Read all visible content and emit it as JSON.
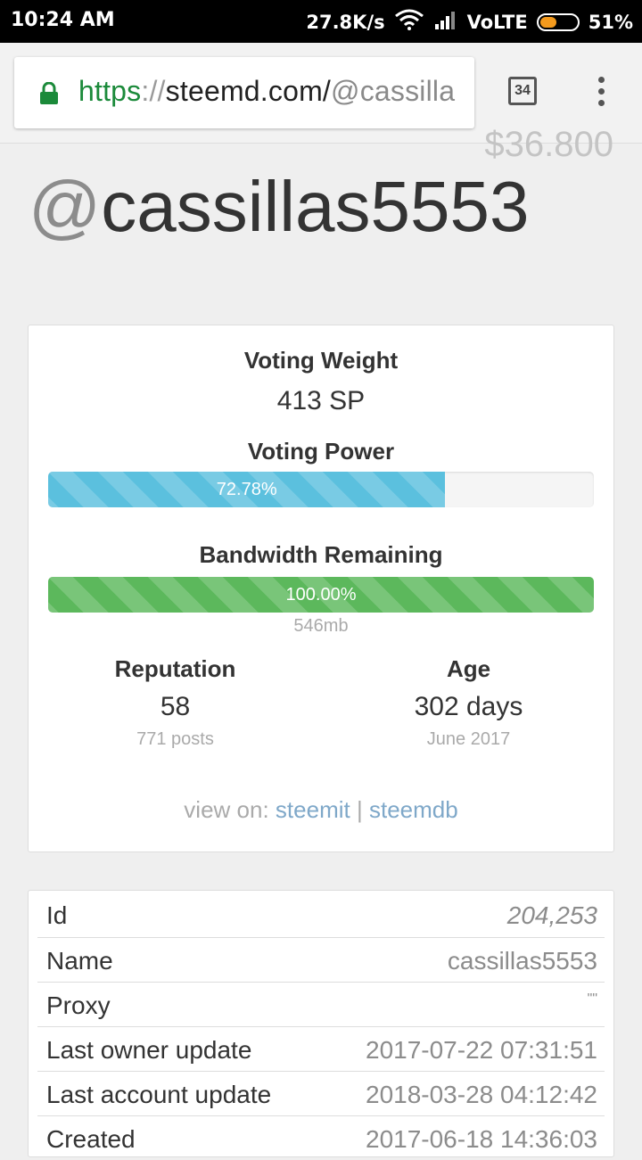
{
  "status_bar": {
    "time": "10:24 AM",
    "speed": "27.8K/s",
    "network": "VoLTE",
    "battery": "51%",
    "battery_level": 0.51,
    "icons": [
      "wifi-icon",
      "signal-icon",
      "battery-icon"
    ]
  },
  "browser": {
    "url_scheme": "https",
    "url_sep": "://",
    "url_host": "steemd.com/",
    "url_path": "@cassilla",
    "tab_count": "34",
    "icons": [
      "lock-icon",
      "menu-icon"
    ]
  },
  "page": {
    "cutoff_value": "$36.800",
    "username_at": "@",
    "username": "cassillas5553"
  },
  "stats": {
    "voting_weight_label": "Voting Weight",
    "voting_weight_value": "413 SP",
    "voting_power_label": "Voting Power",
    "voting_power_text": "72.78%",
    "voting_power_percent": 72.78,
    "bandwidth_label": "Bandwidth Remaining",
    "bandwidth_text": "100.00%",
    "bandwidth_percent": 100,
    "bandwidth_size": "546mb",
    "reputation_label": "Reputation",
    "reputation_value": "58",
    "reputation_sub": "771 posts",
    "age_label": "Age",
    "age_value": "302 days",
    "age_sub": "June 2017",
    "view_on_label": "view on:",
    "link_steemit": "steemit",
    "link_sep": "|",
    "link_steemdb": "steemdb",
    "colors": {
      "voting_power": "#5bc0de",
      "bandwidth": "#5cb85c"
    }
  },
  "account_table": {
    "rows": [
      {
        "key": "Id",
        "value": "204,253"
      },
      {
        "key": "Name",
        "value": "cassillas5553"
      },
      {
        "key": "Proxy",
        "value": "\"\""
      },
      {
        "key": "Last owner update",
        "value": "2017-07-22 07:31:51"
      },
      {
        "key": "Last account update",
        "value": "2018-03-28 04:12:42"
      },
      {
        "key": "Created",
        "value": "2017-06-18 14:36:03"
      }
    ]
  }
}
